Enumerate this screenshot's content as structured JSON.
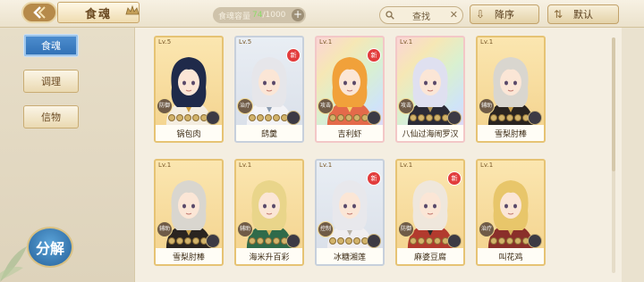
{
  "header": {
    "title": "食魂",
    "capacity_label": "食魂容量",
    "capacity_current": "74",
    "capacity_max": "/1000",
    "search_label": "查找",
    "sort_order": "降序",
    "sort_mode": "默认"
  },
  "sidebar": {
    "tabs": [
      {
        "label": "食魂",
        "active": true
      },
      {
        "label": "调理",
        "active": false
      },
      {
        "label": "信物",
        "active": false
      }
    ],
    "decompose_label": "分解"
  },
  "cards": [
    {
      "level": "Lv.5",
      "name": "锅包肉",
      "role": "防御",
      "frame": "gold",
      "new": false,
      "hair": "#1f2a4a",
      "outfit": "#f4ede0",
      "accent": "#c99a3c"
    },
    {
      "level": "Lv.5",
      "name": "鸱羹",
      "role": "治疗",
      "frame": "silver",
      "new": true,
      "hair": "#e6e6ea",
      "outfit": "#f3f3f6",
      "accent": "#8a9bb0"
    },
    {
      "level": "Lv.1",
      "name": "吉利虾",
      "role": "攻击",
      "frame": "rainbow",
      "new": true,
      "hair": "#f1a13a",
      "outfit": "#e46a4a",
      "accent": "#f6d26a"
    },
    {
      "level": "Lv.1",
      "name": "八仙过海闹罗汉",
      "role": "攻击",
      "frame": "rainbow",
      "new": false,
      "hair": "#dfe0f0",
      "outfit": "#2b2b36",
      "accent": "#b79a5c"
    },
    {
      "level": "Lv.1",
      "name": "雪梨肘棒",
      "role": "辅助",
      "frame": "gold",
      "new": false,
      "hair": "#d9d6cf",
      "outfit": "#2a2420",
      "accent": "#caa24e"
    },
    {
      "level": "Lv.1",
      "name": "雪梨肘棒",
      "role": "辅助",
      "frame": "gold",
      "new": false,
      "hair": "#d9d6cf",
      "outfit": "#2a2420",
      "accent": "#caa24e"
    },
    {
      "level": "Lv.1",
      "name": "海米升百彩",
      "role": "辅助",
      "frame": "gold",
      "new": false,
      "hair": "#e9d58a",
      "outfit": "#2f6a4a",
      "accent": "#d8b35a"
    },
    {
      "level": "Lv.1",
      "name": "冰糖湘莲",
      "role": "控制",
      "frame": "silver",
      "new": true,
      "hair": "#e8e8ec",
      "outfit": "#f0eef0",
      "accent": "#b9b3a8"
    },
    {
      "level": "Lv.1",
      "name": "麻婆豆腐",
      "role": "防御",
      "frame": "gold",
      "new": true,
      "hair": "#efe7dc",
      "outfit": "#b23a2e",
      "accent": "#2b2b2b"
    },
    {
      "level": "Lv.1",
      "name": "叫花鸡",
      "role": "治疗",
      "frame": "gold",
      "new": false,
      "hair": "#e8c66a",
      "outfit": "#8a2f2a",
      "accent": "#d8b35a"
    }
  ],
  "colors": {
    "accent": "#3a7cc3",
    "gold": "#e6c374"
  }
}
